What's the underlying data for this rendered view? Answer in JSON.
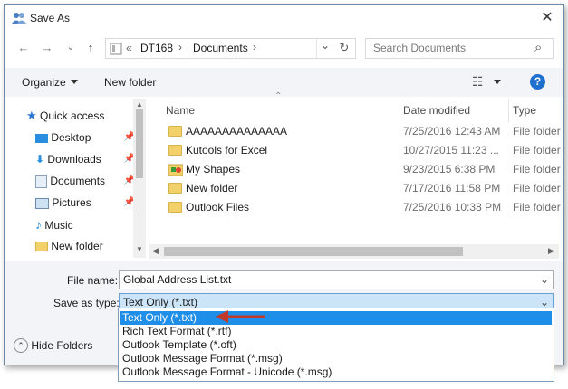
{
  "window": {
    "title": "Save As",
    "close_glyph": "✕"
  },
  "nav": {
    "back": "←",
    "forward": "→",
    "chevron": "⌄",
    "up": "↑"
  },
  "address": {
    "prefix": "«",
    "crumbs": [
      "DT168",
      "Documents"
    ],
    "sep": "›",
    "dropdown": "⌄",
    "refresh": "↻"
  },
  "search": {
    "placeholder": "Search Documents",
    "icon": "⌕"
  },
  "toolbar": {
    "organize": "Organize",
    "new_folder": "New folder",
    "view_glyph": "☷",
    "help": "?"
  },
  "sidebar": {
    "items": [
      {
        "label": "Quick access",
        "icon": "star-icon"
      },
      {
        "label": "Desktop",
        "icon": "desktop-icon",
        "pinned": true
      },
      {
        "label": "Downloads",
        "icon": "download-icon",
        "pinned": true
      },
      {
        "label": "Documents",
        "icon": "documents-icon",
        "pinned": true
      },
      {
        "label": "Pictures",
        "icon": "pictures-icon",
        "pinned": true
      },
      {
        "label": "Music",
        "icon": "music-icon"
      },
      {
        "label": "New folder",
        "icon": "folder-icon"
      }
    ]
  },
  "columns": {
    "name": "Name",
    "date": "Date modified",
    "type": "Type"
  },
  "files": [
    {
      "name": "AAAAAAAAAAAAAA",
      "date": "7/25/2016 12:43 AM",
      "type": "File folder",
      "icon": "folder-icon"
    },
    {
      "name": "Kutools for Excel",
      "date": "10/27/2015 11:23 ...",
      "type": "File folder",
      "icon": "folder-icon"
    },
    {
      "name": "My Shapes",
      "date": "9/23/2015 6:38 PM",
      "type": "File folder",
      "icon": "shapes-folder-icon"
    },
    {
      "name": "New folder",
      "date": "7/17/2016 11:58 PM",
      "type": "File folder",
      "icon": "folder-icon"
    },
    {
      "name": "Outlook Files",
      "date": "7/25/2016 10:38 PM",
      "type": "File folder",
      "icon": "folder-icon"
    }
  ],
  "form": {
    "file_name_label": "File name:",
    "file_name_value": "Global Address List.txt",
    "save_type_label": "Save as type:",
    "save_type_value": "Text Only (*.txt)"
  },
  "type_options": [
    "Text Only (*.txt)",
    "Rich Text Format (*.rtf)",
    "Outlook Template (*.oft)",
    "Outlook Message Format (*.msg)",
    "Outlook Message Format - Unicode (*.msg)"
  ],
  "selected_option_index": 0,
  "hide_folders": {
    "label": "Hide Folders",
    "glyph": "⌃"
  },
  "colors": {
    "accent": "#1e8ee8",
    "arrow": "#c0392b",
    "help": "#1f6fcf"
  }
}
